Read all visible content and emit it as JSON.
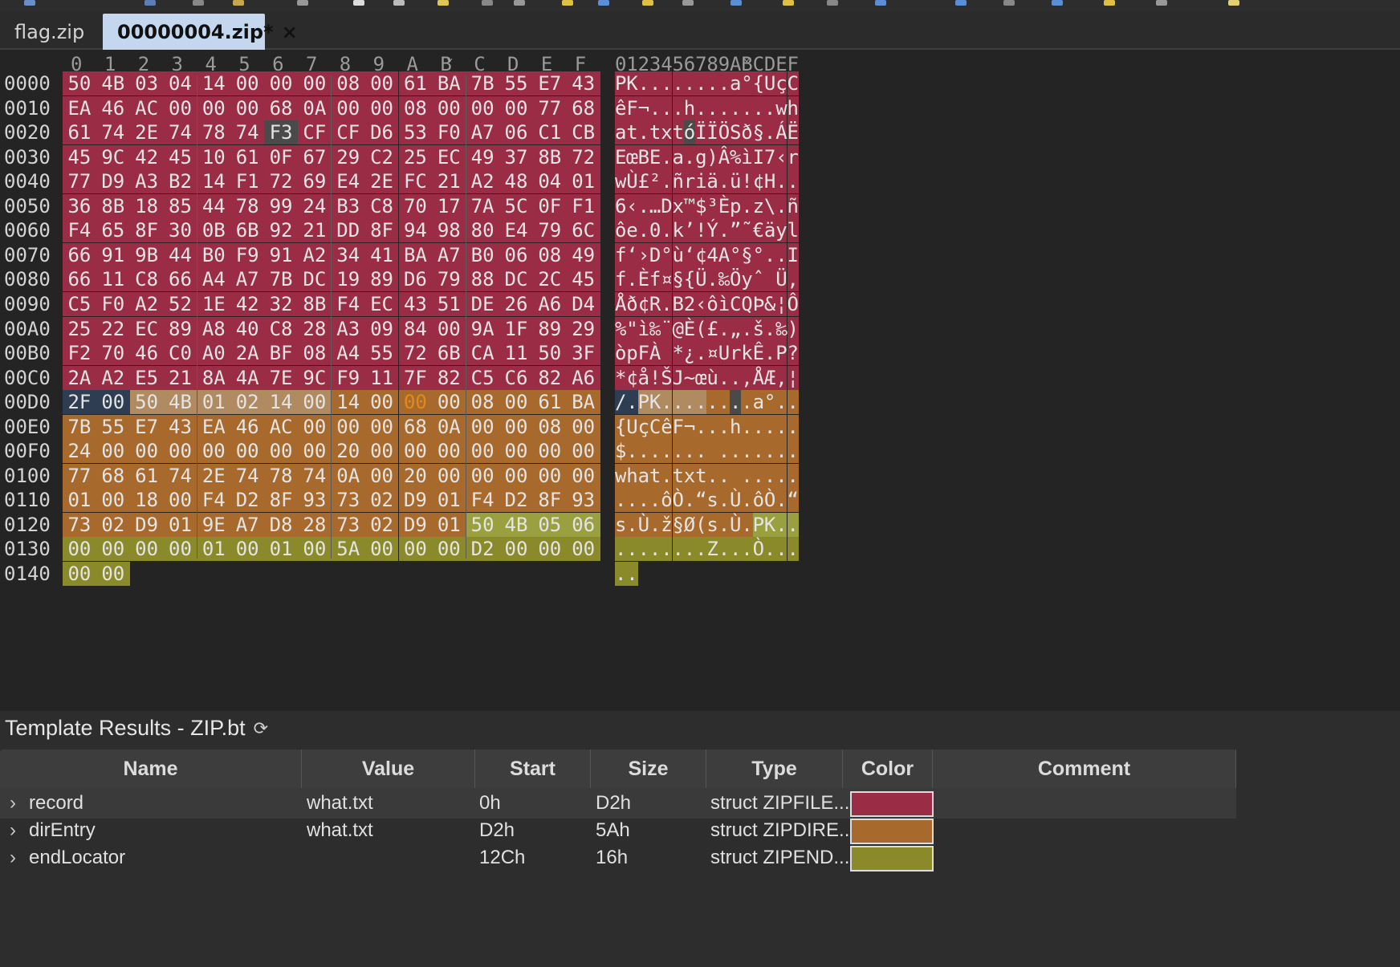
{
  "tabs": [
    {
      "label": "flag.zip",
      "active": false
    },
    {
      "label": "00000004.zip*",
      "active": true
    }
  ],
  "tab_close_glyph": "×",
  "hex": {
    "column_headers": [
      "0",
      "1",
      "2",
      "3",
      "4",
      "5",
      "6",
      "7",
      "8",
      "9",
      "A",
      "B",
      "C",
      "D",
      "E",
      "F"
    ],
    "ascii_header": "0123456789ABCDEF",
    "rows": [
      {
        "addr": "0000",
        "bytes": [
          "50",
          "4B",
          "03",
          "04",
          "14",
          "00",
          "00",
          "00",
          "08",
          "00",
          "61",
          "BA",
          "7B",
          "55",
          "E7",
          "43"
        ],
        "ascii": "PK........a°{UçC"
      },
      {
        "addr": "0010",
        "bytes": [
          "EA",
          "46",
          "AC",
          "00",
          "00",
          "00",
          "68",
          "0A",
          "00",
          "00",
          "08",
          "00",
          "00",
          "00",
          "77",
          "68"
        ],
        "ascii": "êF¬...h.......wh"
      },
      {
        "addr": "0020",
        "bytes": [
          "61",
          "74",
          "2E",
          "74",
          "78",
          "74",
          "F3",
          "CF",
          "CF",
          "D6",
          "53",
          "F0",
          "A7",
          "06",
          "C1",
          "CB"
        ],
        "ascii": "at.txtóÏÏÖSð§.ÁË"
      },
      {
        "addr": "0030",
        "bytes": [
          "45",
          "9C",
          "42",
          "45",
          "10",
          "61",
          "0F",
          "67",
          "29",
          "C2",
          "25",
          "EC",
          "49",
          "37",
          "8B",
          "72"
        ],
        "ascii": "EœBE.a.g)Â%ìI7‹r"
      },
      {
        "addr": "0040",
        "bytes": [
          "77",
          "D9",
          "A3",
          "B2",
          "14",
          "F1",
          "72",
          "69",
          "E4",
          "2E",
          "FC",
          "21",
          "A2",
          "48",
          "04",
          "01"
        ],
        "ascii": "wÙ£².ñriä.ü!¢H.."
      },
      {
        "addr": "0050",
        "bytes": [
          "36",
          "8B",
          "18",
          "85",
          "44",
          "78",
          "99",
          "24",
          "B3",
          "C8",
          "70",
          "17",
          "7A",
          "5C",
          "0F",
          "F1"
        ],
        "ascii": "6‹.…Dx™$³Èp.z\\.ñ"
      },
      {
        "addr": "0060",
        "bytes": [
          "F4",
          "65",
          "8F",
          "30",
          "0B",
          "6B",
          "92",
          "21",
          "DD",
          "8F",
          "94",
          "98",
          "80",
          "E4",
          "79",
          "6C"
        ],
        "ascii": "ôe.0.k’!Ý.”˜€äyl"
      },
      {
        "addr": "0070",
        "bytes": [
          "66",
          "91",
          "9B",
          "44",
          "B0",
          "F9",
          "91",
          "A2",
          "34",
          "41",
          "BA",
          "A7",
          "B0",
          "06",
          "08",
          "49"
        ],
        "ascii": "f‘›D°ù‘¢4A°§°..I"
      },
      {
        "addr": "0080",
        "bytes": [
          "66",
          "11",
          "C8",
          "66",
          "A4",
          "A7",
          "7B",
          "DC",
          "19",
          "89",
          "D6",
          "79",
          "88",
          "DC",
          "2C",
          "45"
        ],
        "ascii": "f.Èf¤§{Ü.‰Öyˆ Ü,E"
      },
      {
        "addr": "0090",
        "bytes": [
          "C5",
          "F0",
          "A2",
          "52",
          "1E",
          "42",
          "32",
          "8B",
          "F4",
          "EC",
          "43",
          "51",
          "DE",
          "26",
          "A6",
          "D4"
        ],
        "ascii": "Åð¢R.B2‹ôìCQÞ&¦Ô"
      },
      {
        "addr": "00A0",
        "bytes": [
          "25",
          "22",
          "EC",
          "89",
          "A8",
          "40",
          "C8",
          "28",
          "A3",
          "09",
          "84",
          "00",
          "9A",
          "1F",
          "89",
          "29"
        ],
        "ascii": "%\"ì‰¨@È(£.„.š.‰)"
      },
      {
        "addr": "00B0",
        "bytes": [
          "F2",
          "70",
          "46",
          "C0",
          "A0",
          "2A",
          "BF",
          "08",
          "A4",
          "55",
          "72",
          "6B",
          "CA",
          "11",
          "50",
          "3F"
        ],
        "ascii": "òpFÀ *¿.¤UrkÊ.P?"
      },
      {
        "addr": "00C0",
        "bytes": [
          "2A",
          "A2",
          "E5",
          "21",
          "8A",
          "4A",
          "7E",
          "9C",
          "F9",
          "11",
          "7F",
          "82",
          "C5",
          "C6",
          "82",
          "A6"
        ],
        "ascii": "*¢å!ŠJ~œù..‚ÅÆ‚¦"
      },
      {
        "addr": "00D0",
        "bytes": [
          "2F",
          "00",
          "50",
          "4B",
          "01",
          "02",
          "14",
          "00",
          "14",
          "00",
          "00",
          "00",
          "08",
          "00",
          "61",
          "BA"
        ],
        "ascii": "/.PK........a°"
      },
      {
        "addr": "00E0",
        "bytes": [
          "7B",
          "55",
          "E7",
          "43",
          "EA",
          "46",
          "AC",
          "00",
          "00",
          "00",
          "68",
          "0A",
          "00",
          "00",
          "08",
          "00"
        ],
        "ascii": "{UçCêF¬...h....."
      },
      {
        "addr": "00F0",
        "bytes": [
          "24",
          "00",
          "00",
          "00",
          "00",
          "00",
          "00",
          "00",
          "20",
          "00",
          "00",
          "00",
          "00",
          "00",
          "00",
          "00"
        ],
        "ascii": "$....... ......."
      },
      {
        "addr": "0100",
        "bytes": [
          "77",
          "68",
          "61",
          "74",
          "2E",
          "74",
          "78",
          "74",
          "0A",
          "00",
          "20",
          "00",
          "00",
          "00",
          "00",
          "00"
        ],
        "ascii": "what.txt.. ....."
      },
      {
        "addr": "0110",
        "bytes": [
          "01",
          "00",
          "18",
          "00",
          "F4",
          "D2",
          "8F",
          "93",
          "73",
          "02",
          "D9",
          "01",
          "F4",
          "D2",
          "8F",
          "93"
        ],
        "ascii": "....ôÒ.“s.Ù.ôÒ.“"
      },
      {
        "addr": "0120",
        "bytes": [
          "73",
          "02",
          "D9",
          "01",
          "9E",
          "A7",
          "D8",
          "28",
          "73",
          "02",
          "D9",
          "01",
          "50",
          "4B",
          "05",
          "06"
        ],
        "ascii": "s.Ù.ž§Ø(s.Ù.PK.."
      },
      {
        "addr": "0130",
        "bytes": [
          "00",
          "00",
          "00",
          "00",
          "01",
          "00",
          "01",
          "00",
          "5A",
          "00",
          "00",
          "00",
          "D2",
          "00",
          "00",
          "00"
        ],
        "ascii": "........Z...Ò..."
      },
      {
        "addr": "0140",
        "bytes": [
          "00",
          "00"
        ],
        "ascii": ".."
      }
    ]
  },
  "results": {
    "title": "Template Results - ZIP.bt",
    "refresh_glyph": "⟳",
    "columns": [
      "Name",
      "Value",
      "Start",
      "Size",
      "Type",
      "Color",
      "Comment"
    ],
    "rows": [
      {
        "name": "record",
        "value": "what.txt",
        "start": "0h",
        "size": "D2h",
        "type": "struct ZIPFILE...",
        "color": "#9b2c45",
        "comment": ""
      },
      {
        "name": "dirEntry",
        "value": "what.txt",
        "start": "D2h",
        "size": "5Ah",
        "type": "struct ZIPDIRE...",
        "color": "#a86a2c",
        "comment": ""
      },
      {
        "name": "endLocator",
        "value": "",
        "start": "12Ch",
        "size": "16h",
        "type": "struct ZIPEND...",
        "color": "#8a8a2a",
        "comment": ""
      }
    ]
  },
  "colors": {
    "record": "#9b2c45",
    "dirEntry": "#a86a2c",
    "endLocator": "#8a8a2a",
    "cursor": "#2e3d52",
    "grayed": "#4a4a4a",
    "highlight_text": "#e08a1e"
  },
  "icons": [
    "toolbar-icons",
    "close-icon",
    "refresh-icon",
    "chevron-right-icon"
  ]
}
